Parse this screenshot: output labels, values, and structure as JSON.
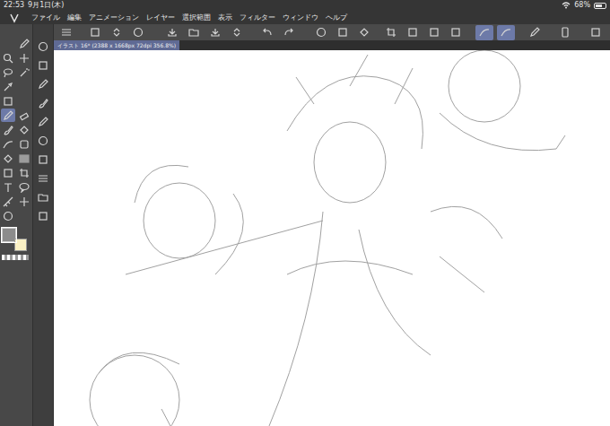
{
  "status_bar": {
    "time": "22:53",
    "date": "9月1日(木)",
    "battery": "68%",
    "battery_level": 0.68
  },
  "menu": [
    "ファイル",
    "編集",
    "アニメーション",
    "レイヤー",
    "選択範囲",
    "表示",
    "フィルター",
    "ウィンドウ",
    "ヘルプ"
  ],
  "command_bar": {
    "buttons": [
      {
        "selected": false
      },
      {
        "selected": false
      },
      {
        "selected": false
      },
      {
        "selected": false
      },
      {
        "selected": false
      },
      {
        "selected": false
      },
      {
        "selected": false
      },
      {
        "selected": false
      },
      {
        "selected": false
      },
      {
        "selected": false
      },
      {
        "selected": false
      },
      {
        "selected": false
      },
      {
        "selected": false
      },
      {
        "selected": false
      },
      {
        "selected": false
      },
      {
        "selected": false
      },
      {
        "selected": false
      },
      {
        "selected": true
      },
      {
        "selected": true
      },
      {
        "selected": false
      },
      {
        "selected": false
      },
      {
        "selected": false
      }
    ]
  },
  "document_tab": {
    "label": "イラスト 16* (2388 x 1668px 72dpi 356.8%)",
    "selected": true
  },
  "tools": [
    {
      "selected": false
    },
    {
      "selected": false
    },
    {
      "selected": false
    },
    {
      "selected": false
    },
    {
      "selected": false
    },
    {
      "selected": false
    },
    {
      "selected": false
    },
    {
      "selected": false
    },
    {
      "selected": false
    },
    {
      "selected": false
    },
    {
      "selected": true
    },
    {
      "selected": false
    },
    {
      "selected": false
    },
    {
      "selected": false
    },
    {
      "selected": false
    },
    {
      "selected": false
    },
    {
      "selected": false
    },
    {
      "selected": false
    },
    {
      "selected": false
    },
    {
      "selected": false
    },
    {
      "selected": false
    },
    {
      "selected": false
    },
    {
      "selected": false
    },
    {
      "selected": false
    },
    {
      "selected": false
    },
    {
      "selected": false
    }
  ],
  "sub_tools": [
    {
      "selected": false
    },
    {
      "selected": false
    },
    {
      "selected": false
    },
    {
      "selected": false
    },
    {
      "selected": false
    },
    {
      "selected": false
    },
    {
      "selected": false
    },
    {
      "selected": false
    },
    {
      "selected": false
    },
    {
      "selected": false
    }
  ],
  "colors": {
    "main": {
      "color": "#8c8c8c",
      "selected": true
    },
    "sub": {
      "color": "#fbf1c4",
      "selected": false
    }
  }
}
